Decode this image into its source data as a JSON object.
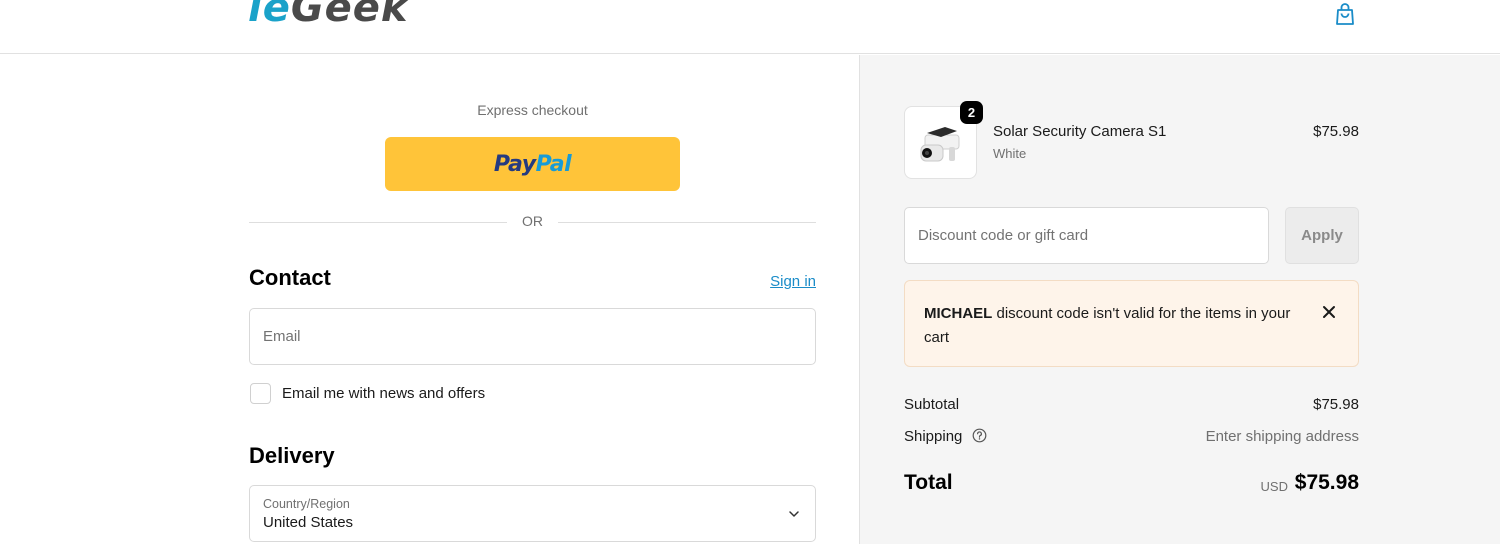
{
  "header": {
    "logo_part1": "ie",
    "logo_part2": "Geek",
    "cart_icon": "shopping-bag-icon"
  },
  "express": {
    "label": "Express checkout",
    "paypal_part1": "Pay",
    "paypal_part2": "Pal",
    "or_text": "OR"
  },
  "contact": {
    "heading": "Contact",
    "sign_in": "Sign in",
    "email_placeholder": "Email",
    "newsletter_label": "Email me with news and offers"
  },
  "delivery": {
    "heading": "Delivery",
    "country_label": "Country/Region",
    "country_value": "United States"
  },
  "summary": {
    "item": {
      "quantity": "2",
      "name": "Solar Security Camera S1",
      "variant": "White",
      "price": "$75.98"
    },
    "discount_placeholder": "Discount code or gift card",
    "apply_label": "Apply",
    "error": {
      "code": "MICHAEL",
      "message": " discount code isn't valid for the items in your cart"
    },
    "subtotal_label": "Subtotal",
    "subtotal_value": "$75.98",
    "shipping_label": "Shipping",
    "shipping_value": "Enter shipping address",
    "total_label": "Total",
    "currency": "USD",
    "total_value": "$75.98"
  },
  "colors": {
    "accent": "#1a8cc8",
    "paypal_yellow": "#ffc439",
    "error_bg": "#fef4ea"
  }
}
